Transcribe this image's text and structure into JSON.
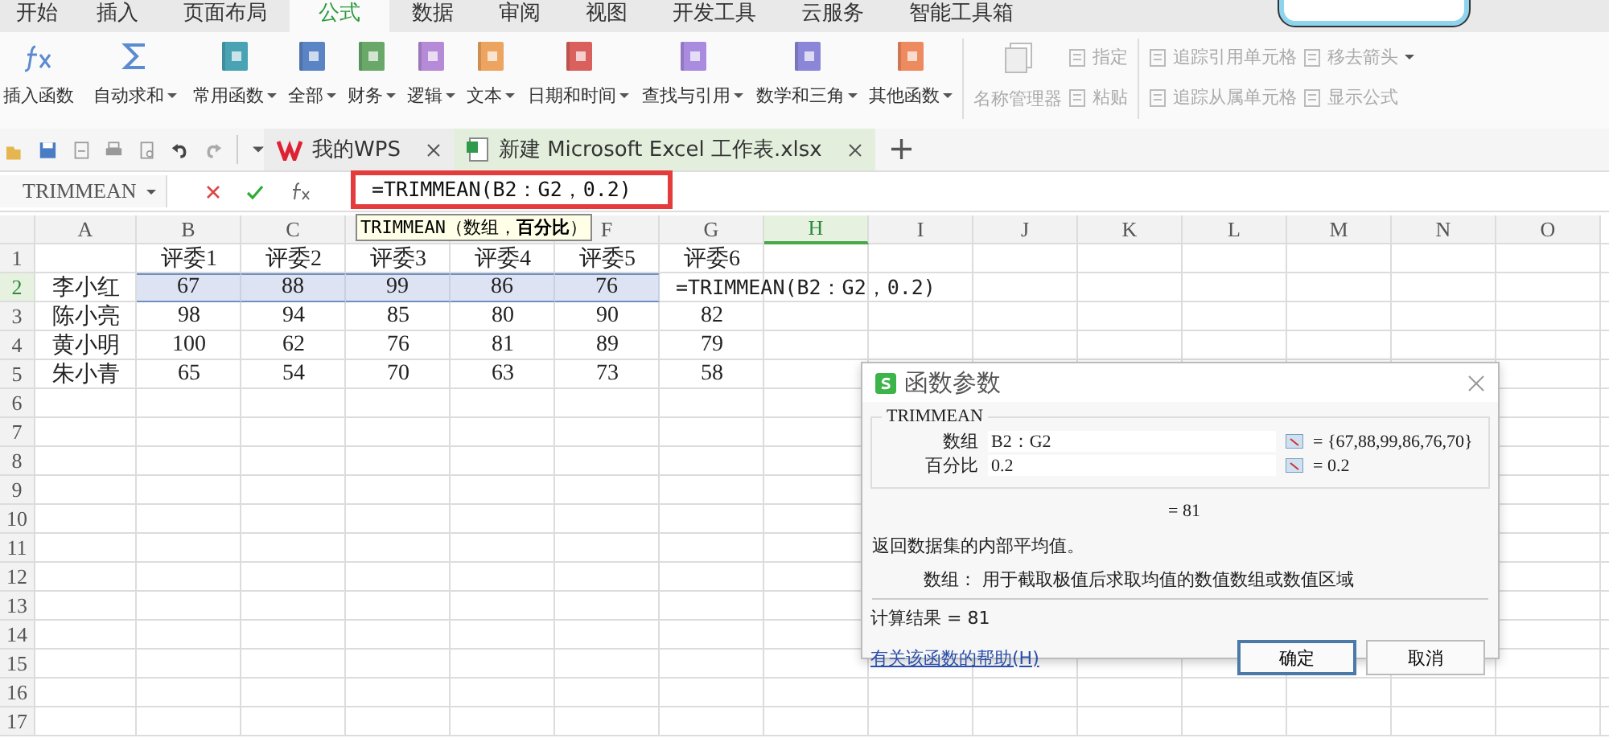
{
  "menu_tabs": [
    {
      "label": "开始",
      "selected": false
    },
    {
      "label": "插入",
      "selected": false
    },
    {
      "label": "页面布局",
      "selected": false
    },
    {
      "label": "公式",
      "selected": true
    },
    {
      "label": "数据",
      "selected": false
    },
    {
      "label": "审阅",
      "selected": false
    },
    {
      "label": "视图",
      "selected": false
    },
    {
      "label": "开发工具",
      "selected": false
    },
    {
      "label": "云服务",
      "selected": false
    },
    {
      "label": "智能工具箱",
      "selected": false
    }
  ],
  "ribbon": {
    "functions": [
      {
        "label": "插入函数",
        "kind": "fx",
        "dropdown": false
      },
      {
        "label": "自动求和",
        "kind": "sigma",
        "dropdown": true
      },
      {
        "label": "常用函数",
        "kind": "book",
        "color": "#4aa3b5",
        "dropdown": true
      },
      {
        "label": "全部",
        "kind": "book",
        "color": "#5b84c4",
        "dropdown": true
      },
      {
        "label": "财务",
        "kind": "book",
        "color": "#6aa86a",
        "dropdown": true
      },
      {
        "label": "逻辑",
        "kind": "book",
        "color": "#b58ad6",
        "dropdown": true
      },
      {
        "label": "文本",
        "kind": "book",
        "color": "#eda460",
        "dropdown": true
      },
      {
        "label": "日期和时间",
        "kind": "book",
        "color": "#d9605d",
        "dropdown": true
      },
      {
        "label": "查找与引用",
        "kind": "book",
        "color": "#a98be0",
        "dropdown": true
      },
      {
        "label": "数学和三角",
        "kind": "book",
        "color": "#8c86d9",
        "dropdown": true
      },
      {
        "label": "其他函数",
        "kind": "book",
        "color": "#ee8a5f",
        "dropdown": true
      }
    ],
    "name_manager": {
      "label": "名称管理器",
      "disabled": true
    },
    "small_columns": [
      [
        {
          "label": "指定",
          "disabled": true,
          "dropdown": false
        },
        {
          "label": "粘贴",
          "disabled": true,
          "dropdown": false
        }
      ],
      [
        {
          "label": "追踪引用单元格",
          "disabled": true,
          "dropdown": false
        },
        {
          "label": "追踪从属单元格",
          "disabled": true,
          "dropdown": false
        }
      ],
      [
        {
          "label": "移去箭头",
          "disabled": true,
          "dropdown": true
        },
        {
          "label": "显示公式",
          "disabled": true,
          "dropdown": false
        }
      ]
    ]
  },
  "doc_tabs": [
    {
      "label": "我的WPS",
      "kind": "home",
      "selected": false
    },
    {
      "label": "新建 Microsoft Excel 工作表.xlsx",
      "kind": "sheet",
      "selected": true
    }
  ],
  "new_tab": "+",
  "formula_bar": {
    "name_box": "TRIMMEAN",
    "formula": "=TRIMMEAN(B2：G2，0.2)",
    "tooltip": "TRIMMEAN（数组，**百分比**）"
  },
  "sheet": {
    "columns": [
      {
        "label": "A",
        "selected": false
      },
      {
        "label": "B",
        "selected": false
      },
      {
        "label": "C",
        "selected": false
      },
      {
        "selected": false
      },
      {
        "selected": false
      },
      {
        "label": "F",
        "selected": false
      },
      {
        "label": "G",
        "selected": false
      },
      {
        "label": "H",
        "selected": true
      },
      {
        "label": "I",
        "selected": false
      },
      {
        "label": "J",
        "selected": false
      },
      {
        "label": "K",
        "selected": false
      },
      {
        "label": "L",
        "selected": false
      },
      {
        "label": "M",
        "selected": false
      },
      {
        "label": "N",
        "selected": false
      },
      {
        "label": "O",
        "selected": false
      }
    ],
    "rows": [
      {
        "number": "1",
        "selected": false,
        "cells": [
          "",
          "评委1",
          "评委2",
          "评委3",
          "评委4",
          "评委5",
          "评委6"
        ]
      },
      {
        "number": "2",
        "selected": true,
        "cells": [
          "李小红",
          "67",
          "88",
          "99",
          "86",
          "76",
          "=TRIMMEAN(B2：G2，0.2)"
        ]
      },
      {
        "number": "3",
        "selected": false,
        "cells": [
          "陈小亮",
          "98",
          "94",
          "85",
          "80",
          "90",
          "82"
        ]
      },
      {
        "number": "4",
        "selected": false,
        "cells": [
          "黄小明",
          "100",
          "62",
          "76",
          "81",
          "89",
          "79"
        ]
      },
      {
        "number": "5",
        "selected": false,
        "cells": [
          "朱小青",
          "65",
          "54",
          "70",
          "63",
          "73",
          "58"
        ]
      },
      {
        "number": "6",
        "selected": false,
        "cells": []
      },
      {
        "number": "7",
        "selected": false,
        "cells": []
      },
      {
        "number": "8",
        "selected": false,
        "cells": []
      },
      {
        "number": "9",
        "selected": false,
        "cells": []
      },
      {
        "number": "10",
        "selected": false,
        "cells": []
      },
      {
        "number": "11",
        "selected": false,
        "cells": []
      },
      {
        "number": "12",
        "selected": false,
        "cells": []
      },
      {
        "number": "13",
        "selected": false,
        "cells": []
      },
      {
        "number": "14",
        "selected": false,
        "cells": []
      },
      {
        "number": "15",
        "selected": false,
        "cells": []
      },
      {
        "number": "16",
        "selected": false,
        "cells": []
      },
      {
        "number": "17",
        "selected": false,
        "cells": []
      }
    ]
  },
  "dialog": {
    "title": "函数参数",
    "function": "TRIMMEAN",
    "args": [
      {
        "label": "数组",
        "value": "B2：G2",
        "result": "= {67,88,99,86,76,70}"
      },
      {
        "label": "百分比",
        "value": "0.2",
        "result": "= 0.2"
      }
    ],
    "result": "= 81",
    "description": "返回数据集的内部平均值。",
    "arg_help": "数组：  用于截取极值后求取均值的数值数组或数值区域",
    "calc": "计算结果 = 81",
    "help_link": "有关该函数的帮助(H)",
    "buttons": [
      {
        "label": "确定",
        "kind": "default"
      },
      {
        "label": "取消",
        "kind": "normal"
      }
    ]
  }
}
